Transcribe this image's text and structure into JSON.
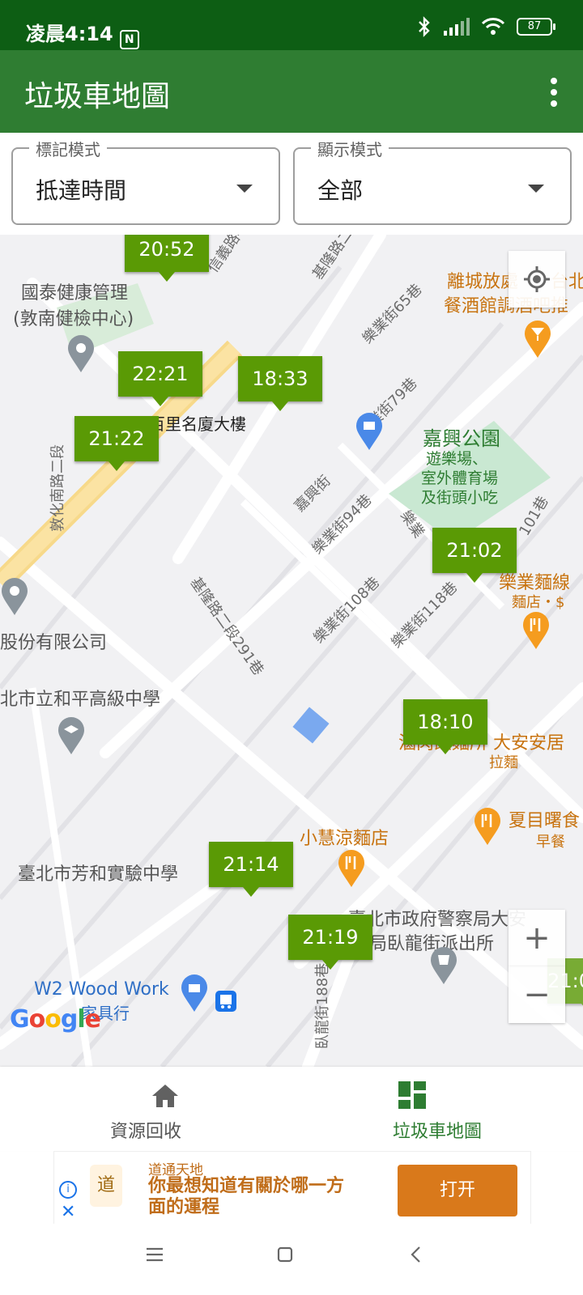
{
  "status_bar": {
    "time": "凌晨4:14",
    "nfc_icon": "N",
    "battery": "87"
  },
  "app_bar": {
    "title": "垃圾車地圖",
    "more_icon": "more-vert-icon"
  },
  "filters": {
    "marker_mode": {
      "label": "標記模式",
      "value": "抵達時間"
    },
    "display_mode": {
      "label": "顯示模式",
      "value": "全部"
    }
  },
  "map": {
    "places": {
      "cathay_line1": "國泰健康管理",
      "cathay_line2": "(敦南健檢中心)",
      "building": "百里名廈大樓",
      "company": "股份有限公司",
      "heping_school": "北市立和平高級中學",
      "fanghe_school": "臺北市芳和實驗中學",
      "bar_line1": "離城放處",
      "bar_line1b": "台北",
      "bar_line2": "餐酒館調酒吧推",
      "jiaxing_park": "嘉興公園",
      "park_desc1": "遊樂場、",
      "park_desc2": "室外體育場",
      "park_desc3": "及街頭小吃",
      "noodle_name": "樂業麵線",
      "noodle_type": "麵店・$",
      "lamian_name": "滷肉飯麵所 大安安居",
      "lamian_type": "拉麵",
      "breakfast_name": "夏目曙食",
      "breakfast_type": "早餐",
      "liang_noodle": "小慧涼麵店",
      "police_line1": "臺北市政府警察局大安",
      "police_line2": "分局臥龍街派出所",
      "woodwork_name": "W2 Wood Work",
      "woodwork_type": "家具行"
    },
    "streets": {
      "dunhua": "敦化南路二段",
      "keelung_top": "基隆路二",
      "keelung_291": "基隆路二段291巷",
      "leye65": "樂業街65巷",
      "leye79": "樂業街79巷",
      "jiaxing": "嘉興街",
      "leye94": "樂業街94巷",
      "leye108": "樂業街108巷",
      "leye118": "樂業街118巷",
      "leye_side": "樂業",
      "leye_101": "101巷",
      "wolong188": "臥龍街188巷",
      "xin4": "信義路4"
    },
    "markers": [
      "20:52",
      "22:21",
      "18:33",
      "21:22",
      "21:02",
      "18:10",
      "21:14",
      "21:19",
      "21:0"
    ],
    "zoom_in": "+",
    "zoom_out": "−",
    "google_logo": [
      "G",
      "o",
      "o",
      "g",
      "l",
      "e"
    ]
  },
  "bottom_nav": {
    "recycle": "資源回收",
    "garbage_map": "垃圾車地圖",
    "active_color": "#2e7d32"
  },
  "ad": {
    "brand": "道通天地",
    "headline": "你最想知道有關於哪一方面的運程",
    "button": "打开",
    "logo_char": "道"
  },
  "colors": {
    "status_bar": "#0d5e14",
    "app_bar": "#2f7d32",
    "marker": "#5a9a05",
    "ad_button": "#d9791b"
  }
}
